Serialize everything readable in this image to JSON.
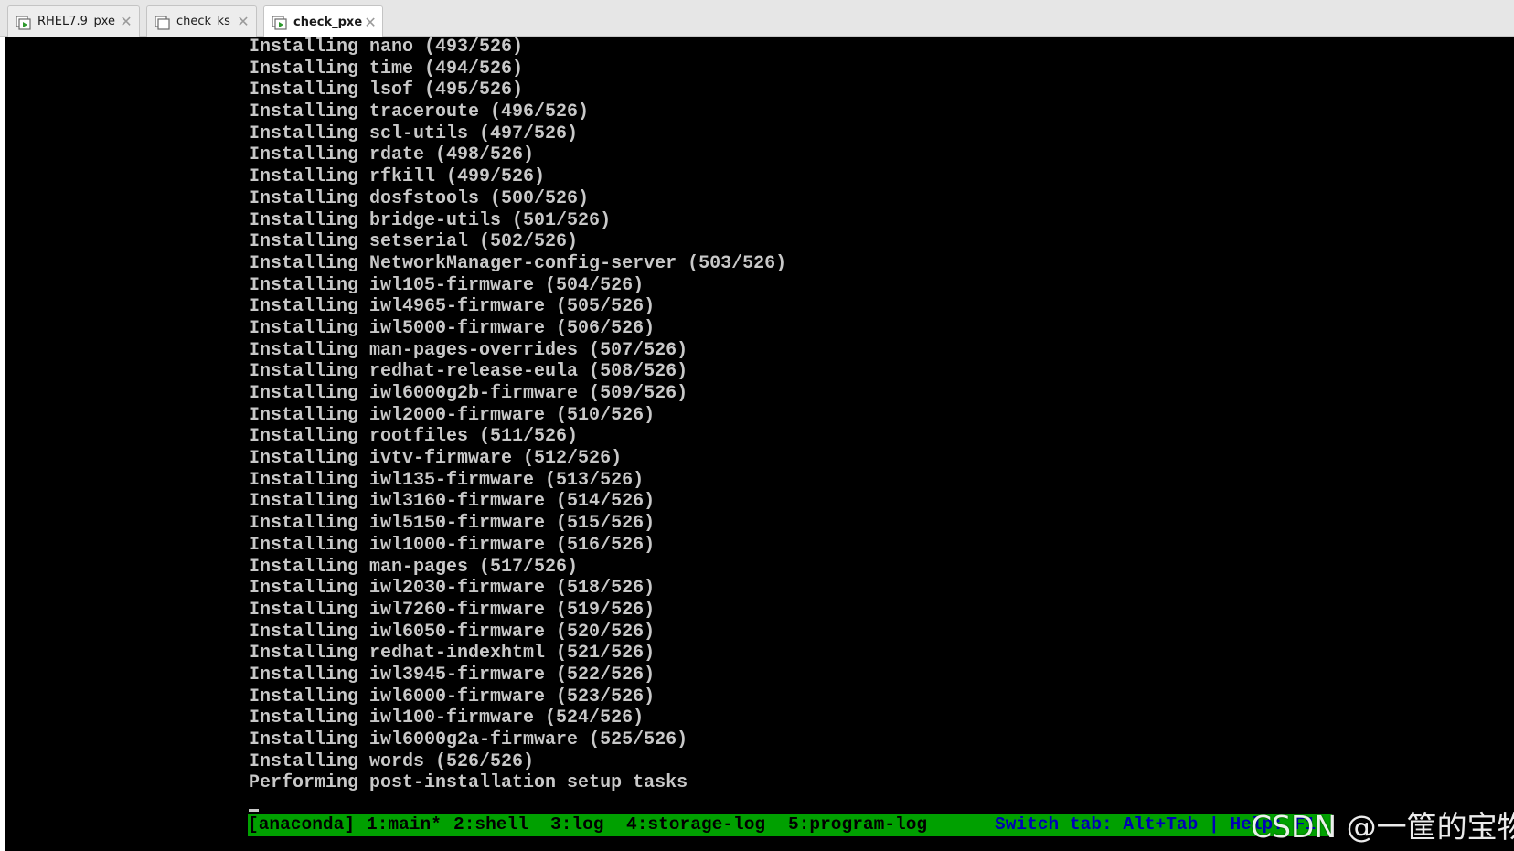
{
  "tabs": [
    {
      "label": "RHEL7.9_pxe",
      "icon": "vm-running-icon",
      "active": false
    },
    {
      "label": "check_ks",
      "icon": "vm-icon",
      "active": false
    },
    {
      "label": "check_pxe",
      "icon": "vm-running-icon",
      "active": true
    }
  ],
  "console": {
    "lines": [
      "Installing nano (493/526)",
      "Installing time (494/526)",
      "Installing lsof (495/526)",
      "Installing traceroute (496/526)",
      "Installing scl-utils (497/526)",
      "Installing rdate (498/526)",
      "Installing rfkill (499/526)",
      "Installing dosfstools (500/526)",
      "Installing bridge-utils (501/526)",
      "Installing setserial (502/526)",
      "Installing NetworkManager-config-server (503/526)",
      "Installing iwl105-firmware (504/526)",
      "Installing iwl4965-firmware (505/526)",
      "Installing iwl5000-firmware (506/526)",
      "Installing man-pages-overrides (507/526)",
      "Installing redhat-release-eula (508/526)",
      "Installing iwl6000g2b-firmware (509/526)",
      "Installing iwl2000-firmware (510/526)",
      "Installing rootfiles (511/526)",
      "Installing ivtv-firmware (512/526)",
      "Installing iwl135-firmware (513/526)",
      "Installing iwl3160-firmware (514/526)",
      "Installing iwl5150-firmware (515/526)",
      "Installing iwl1000-firmware (516/526)",
      "Installing man-pages (517/526)",
      "Installing iwl2030-firmware (518/526)",
      "Installing iwl7260-firmware (519/526)",
      "Installing iwl6050-firmware (520/526)",
      "Installing redhat-indexhtml (521/526)",
      "Installing iwl3945-firmware (522/526)",
      "Installing iwl6000-firmware (523/526)",
      "Installing iwl100-firmware (524/526)",
      "Installing iwl6000g2a-firmware (525/526)",
      "Installing words (526/526)",
      "Performing post-installation setup tasks"
    ]
  },
  "statusbar": {
    "anaconda": "[anaconda]",
    "tabs": [
      "1:main*",
      "2:shell",
      "3:log",
      "4:storage-log",
      "5:program-log"
    ],
    "help": "Switch tab: Alt+Tab | Help: F1"
  },
  "watermark": "CSDN @一筐的宝物",
  "colors": {
    "console_text": "#c8c8c8",
    "console_bg": "#000000",
    "statusbar_bg": "#00a000",
    "statusbar_help": "#0000b8"
  }
}
